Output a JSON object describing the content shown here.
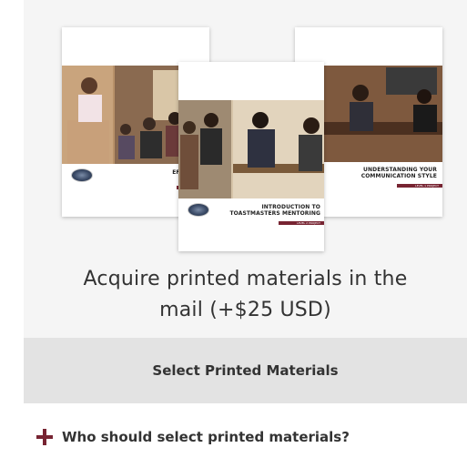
{
  "booklets": {
    "left": {
      "title_line1": "EFFECTIVE",
      "title_line2": "LANG"
    },
    "center": {
      "title_line1": "INTRODUCTION TO",
      "title_line2": "TOASTMASTERS MENTORING",
      "bar_text": "LEVEL 2 PROJECT"
    },
    "right": {
      "title_line1": "UNDERSTANDING YOUR",
      "title_line2": "COMMUNICATION STYLE",
      "bar_text": "LEVEL 1 PROJECT"
    }
  },
  "headline": {
    "line1": "Acquire printed materials in the",
    "line2": "mail (+$25 USD)"
  },
  "select_button": {
    "label": "Select Printed Materials"
  },
  "faq": {
    "label": "Who should select printed materials?"
  },
  "colors": {
    "brand": "#772432",
    "button_bg": "#e3e3e3",
    "card_bg": "#f5f5f5"
  },
  "icons": {
    "faq_toggle": "plus-icon"
  }
}
